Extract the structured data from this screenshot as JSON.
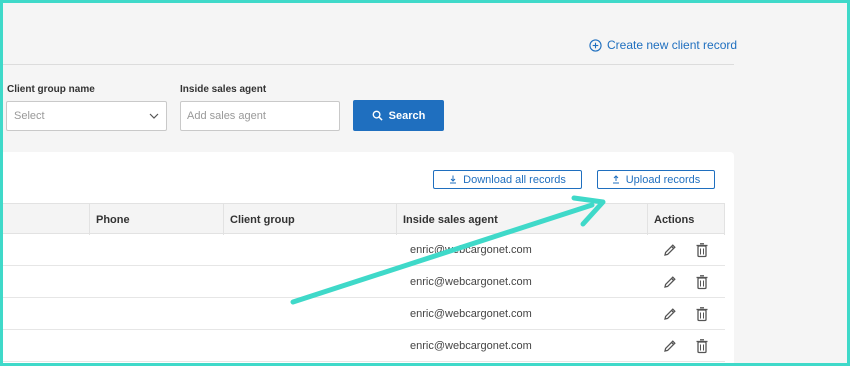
{
  "header": {
    "create_link": "Create new client record",
    "create_icon": "plus-circle-icon"
  },
  "filters": {
    "client_group_label": "Client group name",
    "client_group_placeholder": "Select",
    "sales_agent_label": "Inside sales agent",
    "sales_agent_placeholder": "Add sales agent",
    "search_label": "Search"
  },
  "table_actions": {
    "download_label": "Download all records",
    "upload_label": "Upload records"
  },
  "columns": [
    "Phone",
    "Client group",
    "Inside sales agent",
    "Actions"
  ],
  "rows": [
    {
      "agent": "enric@webcargonet.com"
    },
    {
      "agent": "enric@webcargonet.com"
    },
    {
      "agent": "enric@webcargonet.com"
    },
    {
      "agent": "enric@webcargonet.com"
    }
  ],
  "colors": {
    "accent": "#1f6fbf",
    "annotation_arrow": "#3fd9c9"
  }
}
